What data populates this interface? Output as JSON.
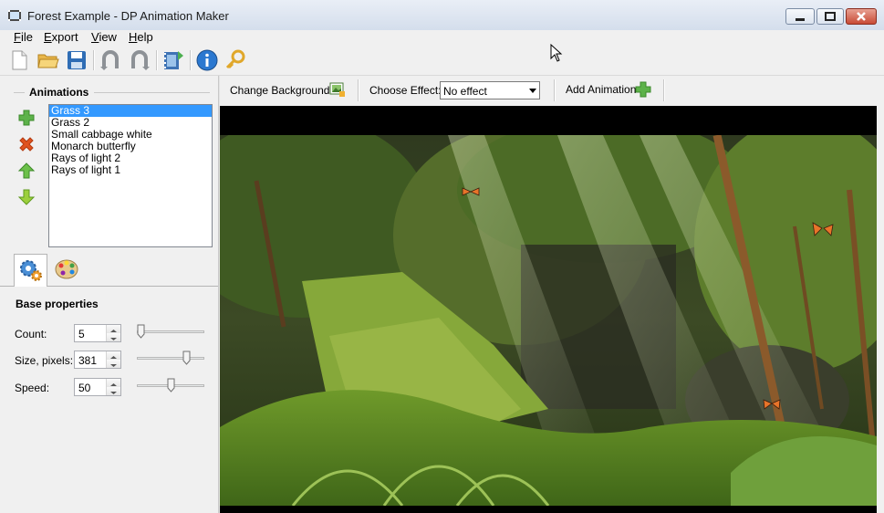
{
  "window": {
    "title": "Forest Example - DP Animation Maker"
  },
  "menu": [
    {
      "label": "File",
      "u": "F",
      "rest": "ile"
    },
    {
      "label": "Export",
      "u": "E",
      "rest": "xport"
    },
    {
      "label": "View",
      "u": "V",
      "rest": "iew"
    },
    {
      "label": "Help",
      "u": "H",
      "rest": "elp"
    }
  ],
  "toolbar": {
    "icons": [
      "new-document-icon",
      "open-folder-icon",
      "save-disk-icon",
      "undo-icon",
      "redo-icon",
      "export-video-icon",
      "info-icon",
      "key-icon"
    ]
  },
  "animations_panel": {
    "title": "Animations",
    "items": [
      "Grass 3",
      "Grass 2",
      "Small cabbage white",
      "Monarch butterfly",
      "Rays of light 2",
      "Rays of light 1"
    ],
    "selected_index": 0
  },
  "tabs": [
    {
      "icon": "gears-icon"
    },
    {
      "icon": "palette-icon"
    }
  ],
  "properties": {
    "title": "Base properties",
    "count": {
      "label": "Count:",
      "value": "5",
      "slider_fraction": 0.0
    },
    "size": {
      "label": "Size, pixels:",
      "value": "381",
      "slider_fraction": 0.77
    },
    "speed": {
      "label": "Speed:",
      "value": "50",
      "slider_fraction": 0.5
    }
  },
  "right_toolbar": {
    "change_background": "Change Background",
    "choose_effect_label": "Choose Effect:",
    "effect_value": "No effect",
    "add_animation": "Add Animation"
  },
  "colors": {
    "selection": "#3399ff",
    "accent_green": "#4caf50",
    "accent_red": "#e0531f"
  }
}
